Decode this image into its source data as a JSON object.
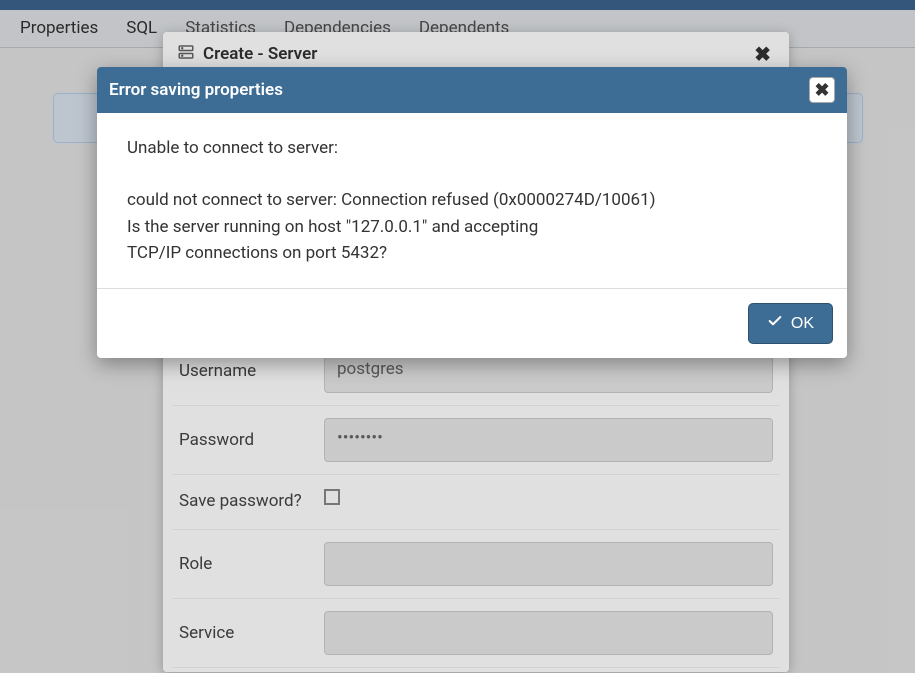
{
  "tabs": {
    "properties": "Properties",
    "sql": "SQL",
    "statistics": "Statistics",
    "dependencies": "Dependencies",
    "dependents": "Dependents"
  },
  "createDialog": {
    "title": "Create - Server",
    "form": {
      "username_label": "Username",
      "username_value": "postgres",
      "password_label": "Password",
      "password_value": "••••••••",
      "save_password_label": "Save password?",
      "role_label": "Role",
      "role_value": "",
      "service_label": "Service",
      "service_value": ""
    }
  },
  "errorDialog": {
    "title": "Error saving properties",
    "line1": "Unable to connect to server:",
    "line2": "could not connect to server: Connection refused (0x0000274D/10061)",
    "line3": "Is the server running on host \"127.0.0.1\" and accepting",
    "line4": "TCP/IP connections on port 5432?",
    "ok_label": "OK"
  }
}
